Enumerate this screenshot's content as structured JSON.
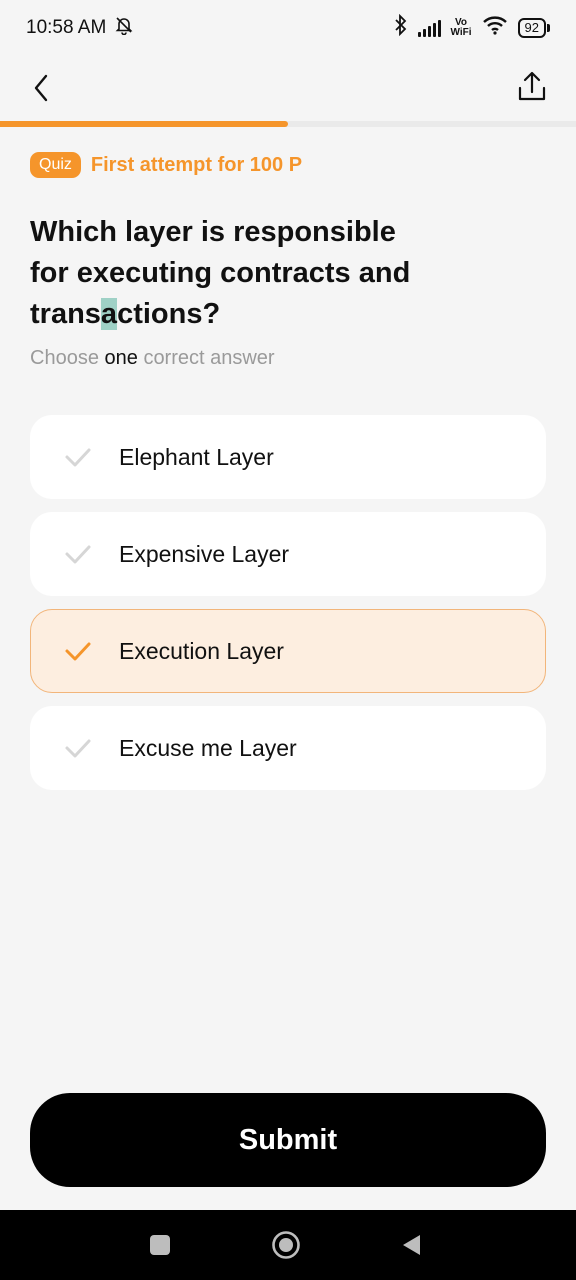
{
  "status_bar": {
    "time": "10:58 AM",
    "vo": "Vo",
    "wifi": "WiFi",
    "battery": "92"
  },
  "progress": {
    "fraction": 0.5
  },
  "quiz": {
    "badge": "Quiz",
    "attempt": "First attempt for 100 P"
  },
  "question": {
    "line1": "Which layer is responsible",
    "line2": "for executing contracts and",
    "line3_pre": "trans",
    "line3_cursor": "a",
    "line3_post": "ctions?"
  },
  "instruction": {
    "pre": "Choose",
    "emphasis": "one",
    "post": "correct answer"
  },
  "options": [
    {
      "label": "Elephant Layer",
      "selected": false
    },
    {
      "label": "Expensive Layer",
      "selected": false
    },
    {
      "label": "Execution Layer",
      "selected": true
    },
    {
      "label": "Excuse me Layer",
      "selected": false
    }
  ],
  "submit": {
    "label": "Submit"
  },
  "colors": {
    "accent": "#f5952b",
    "check_inactive": "#d6d6d6",
    "selected_bg": "#fdeee0"
  }
}
